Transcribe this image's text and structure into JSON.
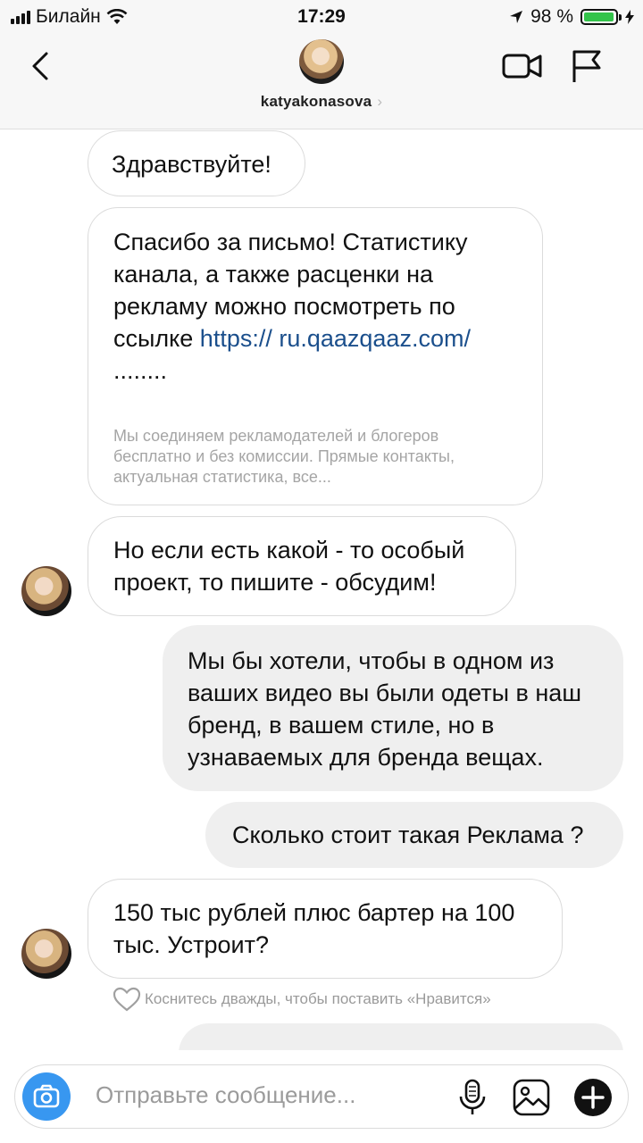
{
  "status_bar": {
    "carrier": "Билайн",
    "time": "17:29",
    "battery": "98 %",
    "battery_level": 0.98
  },
  "header": {
    "username": "katyakonasova",
    "chevron": "›"
  },
  "messages": [
    {
      "side": "in",
      "text": "Здравствуйте!"
    },
    {
      "side": "in",
      "text": "Спасибо за письмо! Статистику канала, а также расценки на рекламу можно посмотреть по ссылке ",
      "link": "https:// ru.qaazqaaz.com/",
      "suffix": " ........",
      "preview": "Мы соединяем рекламодателей и блогеров бесплатно и без комиссии. Прямые контакты, актуальная статистика, все..."
    },
    {
      "side": "in",
      "text": "Но если есть какой - то особый проект, то пишите - обсудим!"
    },
    {
      "side": "out",
      "text": "Мы бы хотели, чтобы в одном из ваших видео вы были одеты в наш бренд, в вашем стиле, но в узнаваемых для бренда вещах."
    },
    {
      "side": "out",
      "text": "Сколько стоит такая Реклама ?"
    },
    {
      "side": "in",
      "text": "150 тыс рублей плюс бартер на 100 тыс.  Устроит?"
    }
  ],
  "like_hint": "Коснитесь дважды, чтобы поставить «Нравится»",
  "composer": {
    "placeholder": "Отправьте сообщение..."
  },
  "icons": {
    "back": "chevron-left-icon",
    "video": "video-camera-icon",
    "flag": "flag-icon",
    "camera": "camera-icon",
    "mic": "microphone-icon",
    "gallery": "image-icon",
    "add": "plus-circle-icon",
    "heart": "heart-icon",
    "location": "location-arrow-icon",
    "wifi": "wifi-icon"
  },
  "colors": {
    "accent": "#3897f0",
    "link": "#1b4f8c",
    "battery": "#33c34a",
    "outgoing_bubble": "#efefef"
  }
}
